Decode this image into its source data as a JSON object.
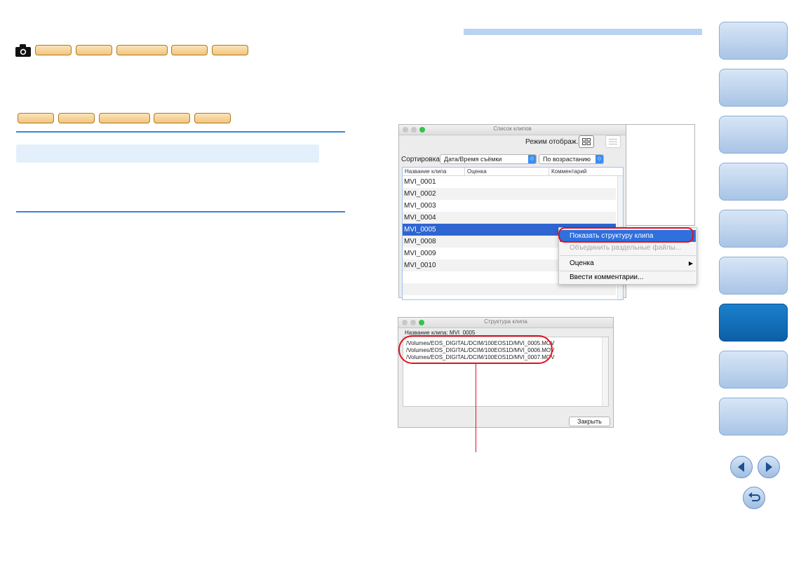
{
  "window_clip_list": {
    "title": "Список клипов",
    "view_mode_label": "Режим отображ.:",
    "sort_label": "Сортировка",
    "sort_by": "Дата/Время съёмки",
    "sort_order": "По возрастанию",
    "columns": [
      "Название клипа",
      "Оценка",
      "Комментарий"
    ],
    "rows": [
      "MVI_0001",
      "MVI_0002",
      "MVI_0003",
      "MVI_0004",
      "MVI_0005",
      "MVI_0008",
      "MVI_0009",
      "MVI_0010"
    ],
    "selected_row": "MVI_0005"
  },
  "context_menu": {
    "items": [
      {
        "label": "Показать структуру клипа",
        "state": "highlighted"
      },
      {
        "label": "Объединить раздельные файлы...",
        "state": "disabled"
      },
      {
        "label": "Оценка",
        "state": "submenu"
      },
      {
        "label": "Ввести комментарии...",
        "state": "normal"
      }
    ],
    "submenu_arrow": "▶"
  },
  "window_clip_structure": {
    "title": "Структура клипа",
    "clip_name": "Название клипа: MVI_0005",
    "files": [
      "/Volumes/EOS_DIGITAL/DCIM/100EOS1D/MVI_0005.MOV",
      "/Volumes/EOS_DIGITAL/DCIM/100EOS1D/MVI_0006.MOV",
      "/Volumes/EOS_DIGITAL/DCIM/100EOS1D/MVI_0007.MOV"
    ],
    "close_button": "Закрыть"
  },
  "icons": {
    "camera": "camera-icon",
    "prev": "arrow-left-icon",
    "next": "arrow-right-icon",
    "back": "return-icon",
    "view_grid": "grid-view-icon",
    "view_list": "list-view-icon"
  },
  "colors": {
    "accent_blue": "#3a86d6",
    "selection_blue": "#2e65d1",
    "highlight_red": "#e0121c",
    "nav_active": "#0c5fa7",
    "tag_orange": "#f1c57f"
  }
}
